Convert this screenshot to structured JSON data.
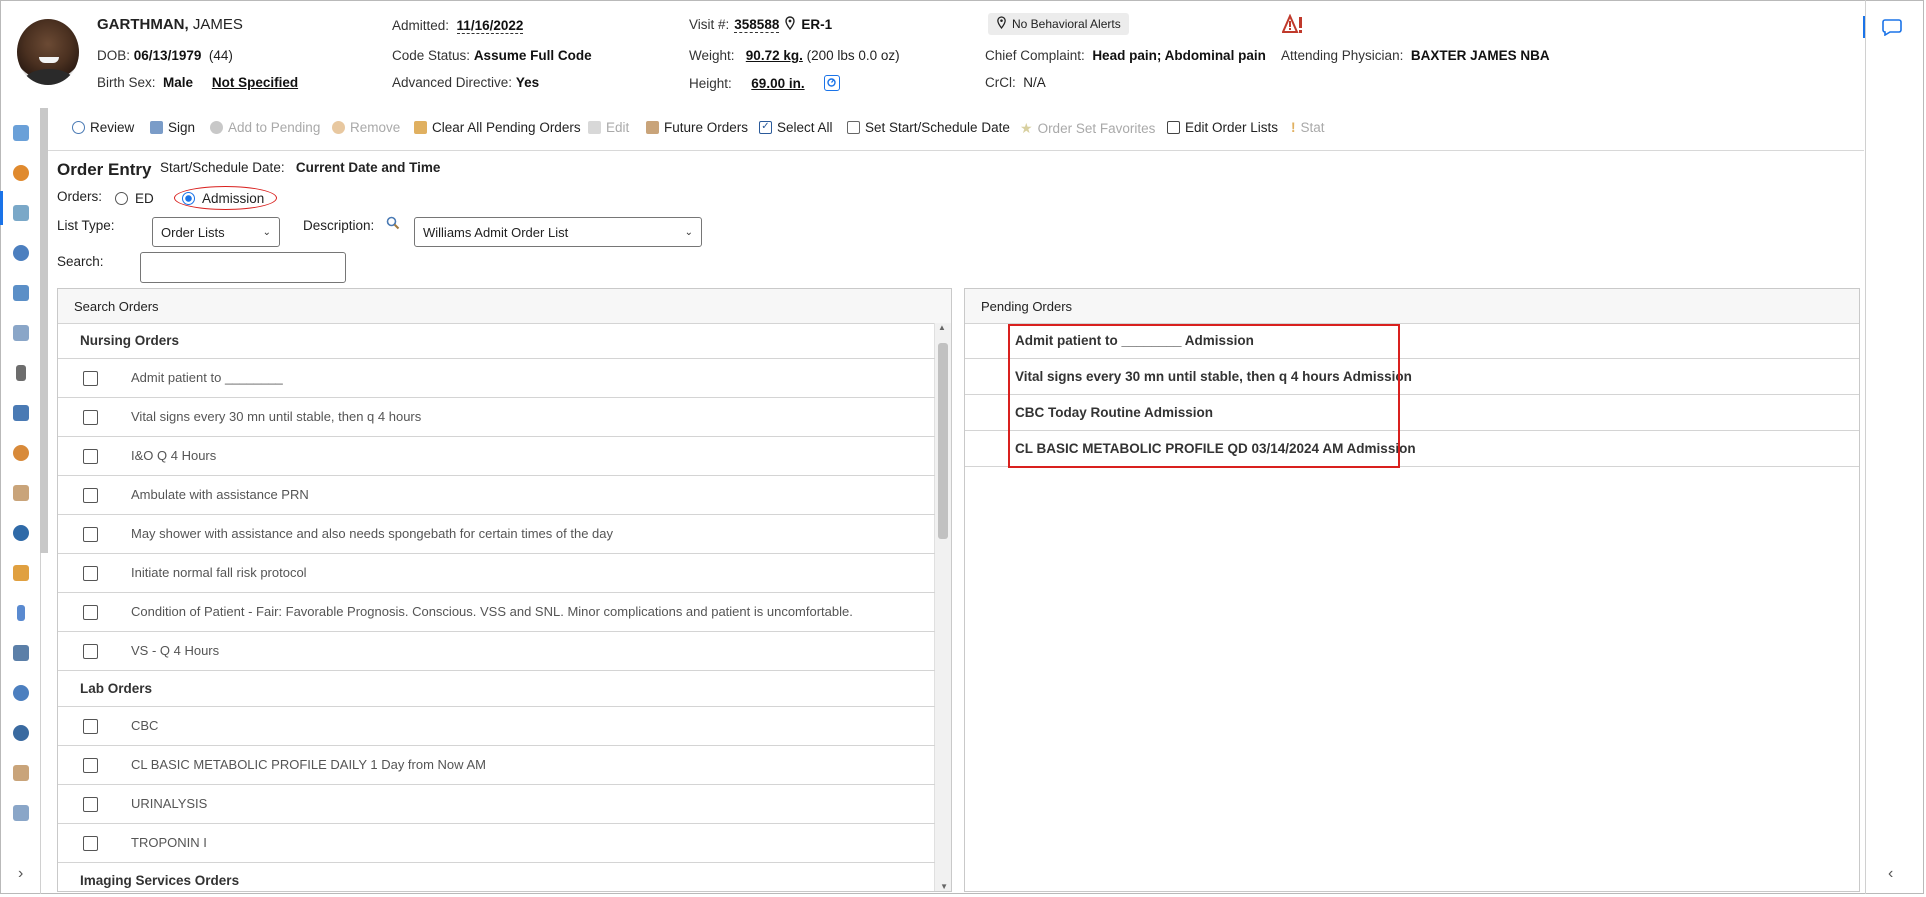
{
  "patient": {
    "last_name": "GARTHMAN,",
    "first_name": "JAMES",
    "dob_label": "DOB:",
    "dob": "06/13/1979",
    "age": "(44)",
    "birth_sex_label": "Birth Sex:",
    "birth_sex": "Male",
    "gender_identity": "Not Specified",
    "admitted_label": "Admitted:",
    "admitted": "11/16/2022",
    "code_status_label": "Code Status:",
    "code_status": "Assume Full Code",
    "advanced_directive_label": "Advanced Directive:",
    "advanced_directive": "Yes",
    "visit_label": "Visit #:",
    "visit": "358588",
    "location": "ER-1",
    "weight_label": "Weight:",
    "weight": "90.72 kg.",
    "weight_alt": "(200 lbs 0.0 oz)",
    "height_label": "Height:",
    "height": "69.00 in.",
    "behavioral_alerts": "No Behavioral Alerts",
    "chief_complaint_label": "Chief Complaint:",
    "chief_complaint": "Head pain; Abdominal pain",
    "crcl_label": "CrCl:",
    "crcl": "N/A",
    "attending_label": "Attending Physician:",
    "attending": "BAXTER JAMES NBA"
  },
  "toolbar": {
    "review": "Review",
    "sign": "Sign",
    "add_to_pending": "Add to Pending",
    "remove": "Remove",
    "clear_all": "Clear All Pending Orders",
    "edit": "Edit",
    "future_orders": "Future Orders",
    "select_all": "Select All",
    "set_start": "Set Start/Schedule Date",
    "favorites": "Order Set Favorites",
    "edit_order_lists": "Edit Order Lists",
    "stat": "Stat"
  },
  "order_entry": {
    "title": "Order Entry",
    "start_label": "Start/Schedule Date:",
    "start_value": "Current Date and Time",
    "orders_label": "Orders:",
    "opt_ed": "ED",
    "opt_admission": "Admission",
    "list_type_label": "List Type:",
    "list_type_value": "Order Lists",
    "description_label": "Description:",
    "description_value": "Williams Admit Order List",
    "search_label": "Search:",
    "search_value": ""
  },
  "search_orders": {
    "header": "Search Orders",
    "groups": [
      {
        "name": "Nursing Orders",
        "items": [
          "Admit patient to ________",
          "Vital signs every 30 mn until stable, then q 4 hours",
          "I&O Q 4 Hours",
          "Ambulate with assistance PRN",
          "May shower with assistance and also needs spongebath for certain times of the day",
          "Initiate normal fall risk protocol",
          "Condition of Patient - Fair: Favorable Prognosis. Conscious. VSS and SNL. Minor complications and patient is uncomfortable.",
          "VS - Q 4 Hours"
        ]
      },
      {
        "name": "Lab Orders",
        "items": [
          "CBC",
          "CL BASIC METABOLIC PROFILE DAILY 1 Day from Now AM",
          "URINALYSIS",
          "TROPONIN I"
        ]
      },
      {
        "name": "Imaging Services Orders",
        "items": []
      }
    ]
  },
  "pending_orders": {
    "header": "Pending Orders",
    "items": [
      "Admit patient to ________ Admission",
      "Vital signs every 30 mn until stable, then q 4 hours Admission",
      "CBC Today Routine Admission",
      "CL BASIC METABOLIC PROFILE QD 03/14/2024 AM Admission"
    ]
  },
  "colors": {
    "accent": "#1a73e8",
    "highlight": "#d9201e",
    "alert": "#c0392b"
  }
}
